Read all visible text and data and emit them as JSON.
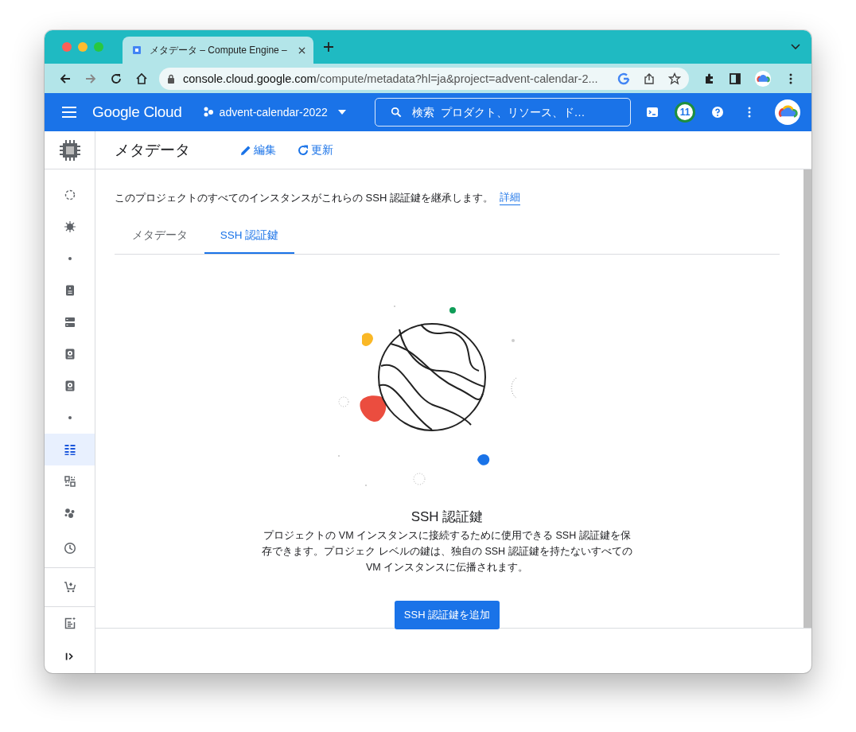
{
  "browser": {
    "tab_title": "メタデータ – Compute Engine –",
    "url_host": "console.cloud.google.com",
    "url_path": "/compute/metadata?hl=ja&project=advent-calendar-2..."
  },
  "topbar": {
    "brand": "Google Cloud",
    "project": "advent-calendar-2022",
    "search_placeholder": "検索  プロダクト、リソース、ド…",
    "notification_count": "11"
  },
  "sidebar": {
    "items": [
      {
        "kind": "loop",
        "selected": false
      },
      {
        "kind": "gear",
        "selected": false
      },
      {
        "kind": "dot",
        "selected": false
      },
      {
        "kind": "badge",
        "selected": false
      },
      {
        "kind": "servers",
        "selected": false
      },
      {
        "kind": "disk",
        "selected": false
      },
      {
        "kind": "disk",
        "selected": false
      },
      {
        "kind": "dot",
        "selected": false
      },
      {
        "kind": "list",
        "selected": true
      },
      {
        "kind": "grid",
        "selected": false
      },
      {
        "kind": "dots",
        "selected": false
      },
      {
        "kind": "clock",
        "selected": false
      },
      {
        "kind": "cart",
        "selected": false
      },
      {
        "kind": "note",
        "selected": false
      }
    ]
  },
  "page": {
    "title": "メタデータ",
    "actions": [
      {
        "kind": "edit",
        "label": "編集"
      },
      {
        "kind": "refresh",
        "label": "更新"
      }
    ],
    "info": "このプロジェクトのすべてのインスタンスがこれらの SSH 認証鍵を継承します。",
    "info_link": "詳細",
    "tabs": [
      {
        "label": "メタデータ",
        "selected": false
      },
      {
        "label": "SSH 認証鍵",
        "selected": true
      }
    ],
    "empty_title": "SSH 認証鍵",
    "empty_text": "プロジェクトの VM インスタンスに接続するために使用できる SSH 認証鍵を保存できます。プロジェク レベルの鍵は、独自の SSH 認証鍵を持たないすべての VM インスタンスに伝播されます。",
    "add_button": "SSH 認証鍵を追加"
  }
}
